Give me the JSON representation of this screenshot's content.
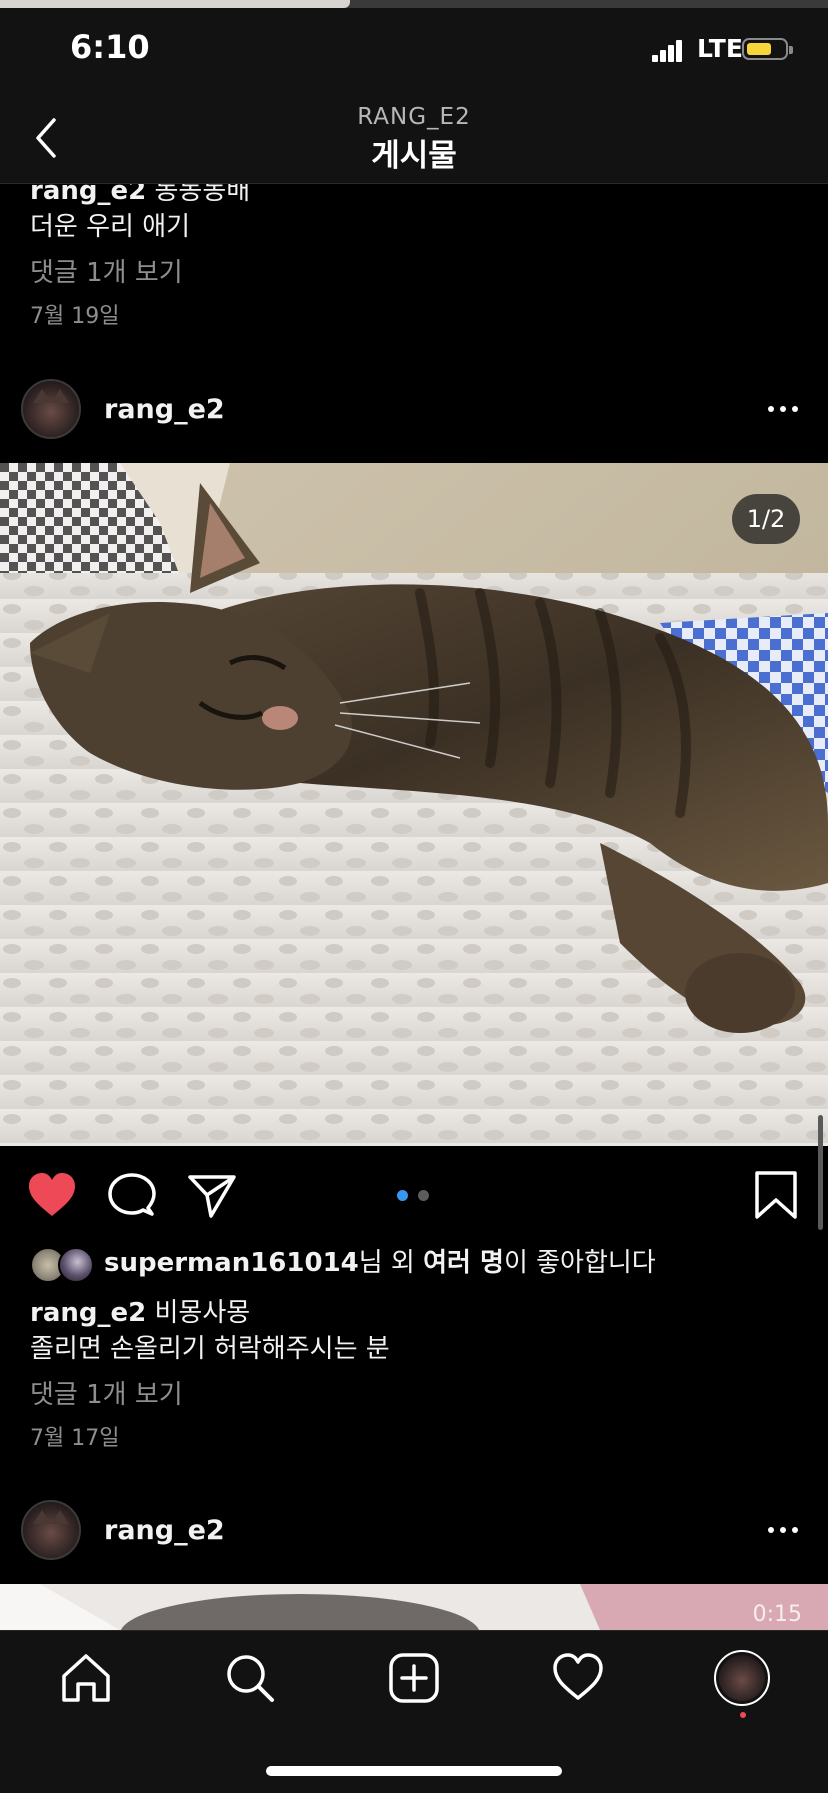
{
  "status_bar": {
    "time": "6:10",
    "network": "LTE",
    "icons": [
      "signal-icon",
      "battery-icon"
    ],
    "battery_fraction": 0.55
  },
  "nav": {
    "username": "RANG_E2",
    "title": "게시물",
    "back_icon": "chevron-left-icon"
  },
  "prev_post": {
    "caption_user": "rang_e2",
    "caption_text": "동동동배",
    "caption_line2": "더운 우리 애기",
    "view_comments": "댓글 1개 보기",
    "date": "7월 19일"
  },
  "post": {
    "username": "rang_e2",
    "image_counter": "1/2",
    "liked_by_user": "superman161014",
    "liked_by_suffix_1": "님 외 ",
    "liked_by_others": "여러 명",
    "liked_by_suffix_2": "이 좋아합니다",
    "caption_user": "rang_e2",
    "caption_text": "비몽사몽",
    "caption_line2": "졸리면 손올리기 허락해주시는 분",
    "view_comments": "댓글 1개 보기",
    "date": "7월 17일",
    "carousel_count": 2,
    "carousel_active": 1,
    "liked": true,
    "colors": {
      "like": "#ed4956",
      "carousel_active": "#3897f0",
      "carousel_inactive": "#5c5c5c"
    }
  },
  "next_post": {
    "username": "rang_e2",
    "video_time": "0:15"
  },
  "tab_bar": {
    "items": [
      "home-icon",
      "search-icon",
      "add-post-icon",
      "activity-heart-icon",
      "profile-avatar-icon"
    ],
    "notification_dot_color": "#ed4956"
  }
}
